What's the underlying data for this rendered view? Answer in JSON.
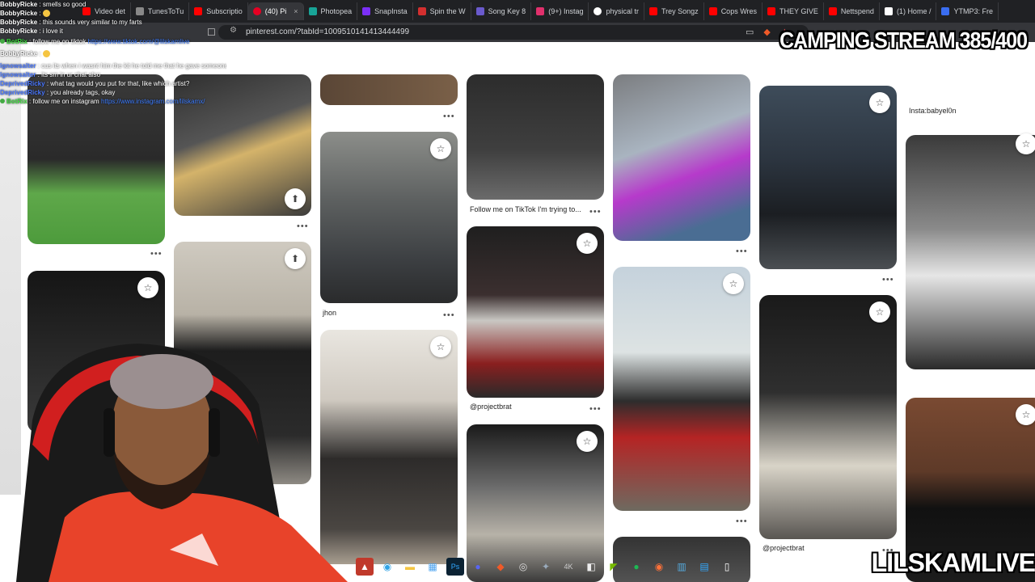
{
  "browser": {
    "tabs": [
      {
        "label": "Video det",
        "color": "#ff0000"
      },
      {
        "label": "TunesToTu",
        "color": "#888888"
      },
      {
        "label": "Subscriptio",
        "color": "#ff0000"
      },
      {
        "label": "(40) Pi",
        "color": "#e60023",
        "active": true
      },
      {
        "label": "Photopea",
        "color": "#18a497"
      },
      {
        "label": "SnapInsta",
        "color": "#7b2ff7"
      },
      {
        "label": "Spin the W",
        "color": "#d32f2f"
      },
      {
        "label": "Song Key 8",
        "color": "#6a5acd"
      },
      {
        "label": "(9+) Instag",
        "color": "#e1306c"
      },
      {
        "label": "physical tr",
        "color": "#ffffff"
      },
      {
        "label": "Trey Songz",
        "color": "#ff0000"
      },
      {
        "label": "Cops Wres",
        "color": "#ff0000"
      },
      {
        "label": "THEY GIVE",
        "color": "#ff0000"
      },
      {
        "label": "Nettspend",
        "color": "#ff0000"
      },
      {
        "label": "(1) Home /",
        "color": "#ffffff"
      },
      {
        "label": "YTMP3: Fre",
        "color": "#3a6df0"
      }
    ],
    "url": "pinterest.com/?tabId=1009510141413444499",
    "close_glyph": "×"
  },
  "chat": [
    {
      "user": "BobbyRicke",
      "text": "smells so good",
      "ucls": "u"
    },
    {
      "user": "BobbyRicke",
      "text": "",
      "ucls": "u"
    },
    {
      "user": "BobbyRicke",
      "text": "this sounds very similar to my farts",
      "ucls": "u"
    },
    {
      "user": "BobbyRicke",
      "text": "i love it",
      "ucls": "u"
    },
    {
      "user": "BotRix",
      "text": "follow me on tiktok",
      "link": "https://www.tiktok.com/@lilskamlive",
      "ucls": "u g"
    },
    {
      "user": "BobbyRicke",
      "text": "",
      "ucls": "u"
    },
    {
      "user": "lgnowsalter",
      "text": "cus its when i wasnt him the kit he told me that he gave someone it",
      "ucls": "u b"
    },
    {
      "user": "lgnowsalter",
      "text": "its sm in ur chat also",
      "ucls": "u b"
    },
    {
      "user": "DeprivedRicky",
      "text": "what tag would you put for that, like which artist?",
      "ucls": "u b"
    },
    {
      "user": "DeprivedRicky",
      "text": "you already tags, okay",
      "ucls": "u b"
    },
    {
      "user": "BotRix",
      "text": "follow me on instagram",
      "link": "https://www.instagram.com/lilskamx/",
      "ucls": "u g"
    }
  ],
  "pins": [
    {
      "caption": "",
      "save": "☆"
    },
    {
      "caption": "",
      "save": "⬆"
    },
    {
      "caption": "jhon",
      "save": "☆"
    },
    {
      "caption": "Follow me on TikTok I'm trying to...",
      "save": "☆"
    },
    {
      "caption": "@projectbrat",
      "save": "☆"
    },
    {
      "caption": "",
      "save": "☆"
    },
    {
      "caption": "",
      "save": "☆"
    },
    {
      "caption": "@projectbrat",
      "save": "☆"
    },
    {
      "caption": "Insta:babyel0n",
      "save": "☆"
    }
  ],
  "overlay": {
    "title": "CAMPING STREAM 385/400",
    "brand": "LILSKAMLIVE"
  },
  "more_glyph": "•••"
}
